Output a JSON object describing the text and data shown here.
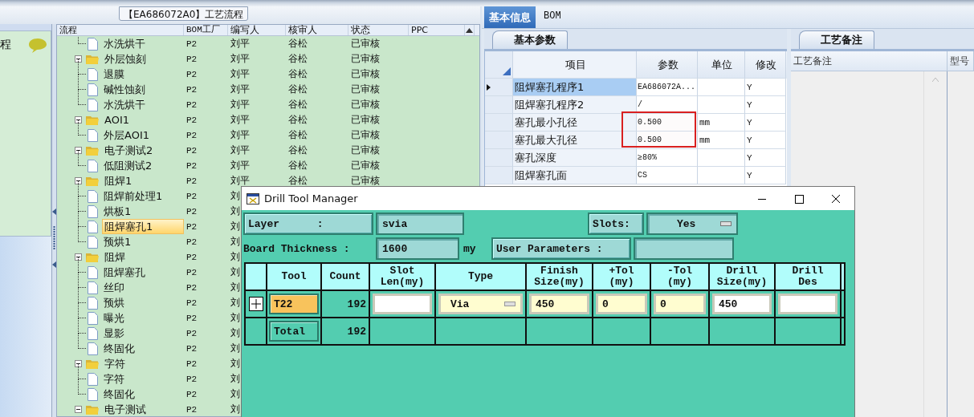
{
  "flow_panel": {
    "title": "【EA686072A0】工艺流程",
    "side_heading": "程",
    "columns": [
      "流程",
      "BOM工厂",
      "编写人",
      "核审人",
      "状态",
      "PPC"
    ],
    "rows": [
      {
        "kind": "file",
        "name": "水洗烘干",
        "bom": "P2",
        "writer": "刘平",
        "auditor": "谷松",
        "status": "已审核",
        "selected": false
      },
      {
        "kind": "folder",
        "name": "外层蚀刻",
        "bom": "P2",
        "writer": "刘平",
        "auditor": "谷松",
        "status": "已审核",
        "selected": false,
        "expanded": true,
        "children": [
          {
            "kind": "file",
            "name": "退膜",
            "bom": "P2",
            "writer": "刘平",
            "auditor": "谷松",
            "status": "已审核",
            "selected": false
          },
          {
            "kind": "file",
            "name": "碱性蚀刻",
            "bom": "P2",
            "writer": "刘平",
            "auditor": "谷松",
            "status": "已审核",
            "selected": false
          },
          {
            "kind": "file",
            "name": "水洗烘干",
            "bom": "P2",
            "writer": "刘平",
            "auditor": "谷松",
            "status": "已审核",
            "selected": false
          }
        ]
      },
      {
        "kind": "folder",
        "name": "AOI1",
        "bom": "P2",
        "writer": "刘平",
        "auditor": "谷松",
        "status": "已审核",
        "selected": false,
        "expanded": true,
        "children": [
          {
            "kind": "file",
            "name": "外层AOI1",
            "bom": "P2",
            "writer": "刘平",
            "auditor": "谷松",
            "status": "已审核",
            "selected": false
          }
        ]
      },
      {
        "kind": "folder",
        "name": "电子测试2",
        "bom": "P2",
        "writer": "刘平",
        "auditor": "谷松",
        "status": "已审核",
        "selected": false,
        "expanded": true,
        "children": [
          {
            "kind": "file",
            "name": "低阻测试2",
            "bom": "P2",
            "writer": "刘平",
            "auditor": "谷松",
            "status": "已审核",
            "selected": false
          }
        ]
      },
      {
        "kind": "folder",
        "name": "阻焊1",
        "bom": "P2",
        "writer": "刘平",
        "auditor": "谷松",
        "status": "已审核",
        "selected": false,
        "expanded": true,
        "children": [
          {
            "kind": "file",
            "name": "阻焊前处理1",
            "bom": "P2",
            "writer": "刘",
            "selected": false
          },
          {
            "kind": "file",
            "name": "烘板1",
            "bom": "P2",
            "writer": "刘",
            "selected": false
          },
          {
            "kind": "file",
            "name": "阻焊塞孔1",
            "bom": "P2",
            "writer": "刘",
            "selected": true
          },
          {
            "kind": "file",
            "name": "预烘1",
            "bom": "P2",
            "writer": "刘",
            "selected": false
          }
        ]
      },
      {
        "kind": "folder",
        "name": "阻焊",
        "bom": "P2",
        "writer": "刘",
        "selected": false,
        "expanded": true,
        "children": [
          {
            "kind": "file",
            "name": "阻焊塞孔",
            "bom": "P2",
            "writer": "刘",
            "selected": false
          },
          {
            "kind": "file",
            "name": "丝印",
            "bom": "P2",
            "writer": "刘",
            "selected": false
          },
          {
            "kind": "file",
            "name": "预烘",
            "bom": "P2",
            "writer": "刘",
            "selected": false
          },
          {
            "kind": "file",
            "name": "曝光",
            "bom": "P2",
            "writer": "刘",
            "selected": false
          },
          {
            "kind": "file",
            "name": "显影",
            "bom": "P2",
            "writer": "刘",
            "selected": false
          },
          {
            "kind": "file",
            "name": "终固化",
            "bom": "P2",
            "writer": "刘",
            "selected": false
          }
        ]
      },
      {
        "kind": "folder",
        "name": "字符",
        "bom": "P2",
        "writer": "刘",
        "selected": false,
        "expanded": true,
        "children": [
          {
            "kind": "file",
            "name": "字符",
            "bom": "P2",
            "writer": "刘",
            "selected": false
          },
          {
            "kind": "file",
            "name": "终固化",
            "bom": "P2",
            "writer": "刘",
            "selected": false
          }
        ]
      },
      {
        "kind": "folder",
        "name": "电子测试",
        "bom": "P2",
        "writer": "刘",
        "selected": false,
        "expanded": true
      }
    ]
  },
  "info_tabs": [
    {
      "label": "基本信息",
      "selected": true
    },
    {
      "label": "BOM",
      "selected": false
    }
  ],
  "params": {
    "tab": "基本参数",
    "columns": [
      "项目",
      "参数",
      "单位",
      "修改"
    ],
    "rows": [
      {
        "item": "阻焊塞孔程序1",
        "value": "EA686072A...",
        "modified": "Y",
        "current": true,
        "marked": false
      },
      {
        "item": "阻焊塞孔程序2",
        "value": "/",
        "modified": "Y",
        "current": false,
        "marked": false
      },
      {
        "item": "塞孔最小孔径",
        "value": "0.500",
        "unit": "mm",
        "modified": "Y",
        "current": false,
        "marked": true
      },
      {
        "item": "塞孔最大孔径",
        "value": "0.500",
        "unit": "mm",
        "modified": "Y",
        "current": false,
        "marked": true
      },
      {
        "item": "塞孔深度",
        "value": "≥80%",
        "modified": "Y",
        "current": false,
        "marked": false
      },
      {
        "item": "阻焊塞孔面",
        "value": "CS",
        "modified": "Y",
        "current": false,
        "marked": false
      }
    ]
  },
  "notes": {
    "tab": "工艺备注",
    "columns": [
      "工艺备注",
      "型号"
    ]
  },
  "dialog": {
    "title": "Drill Tool Manager",
    "layer": {
      "label": "Layer      :",
      "value": "svia"
    },
    "slots": {
      "label": "Slots:",
      "value": "Yes"
    },
    "board_thickness": {
      "label": "Board Thickness :",
      "value": "1600",
      "unit": "my"
    },
    "user_parameters": {
      "label": "User Parameters :"
    },
    "columns": [
      "Tool",
      "Count",
      "Slot\nLen(my)",
      "Type",
      "Finish\nSize(my)",
      "+Tol\n(my)",
      "-Tol\n(my)",
      "Drill\nSize(my)",
      "Drill\nDes"
    ],
    "rows": [
      {
        "kind": "tool",
        "tool": "T22",
        "count": "192",
        "type": "Via",
        "finish_size": "450",
        "plus_tol": "0",
        "minus_tol": "0",
        "drill_size": "450"
      },
      {
        "kind": "total",
        "tool": "Total",
        "count": "192"
      }
    ]
  }
}
